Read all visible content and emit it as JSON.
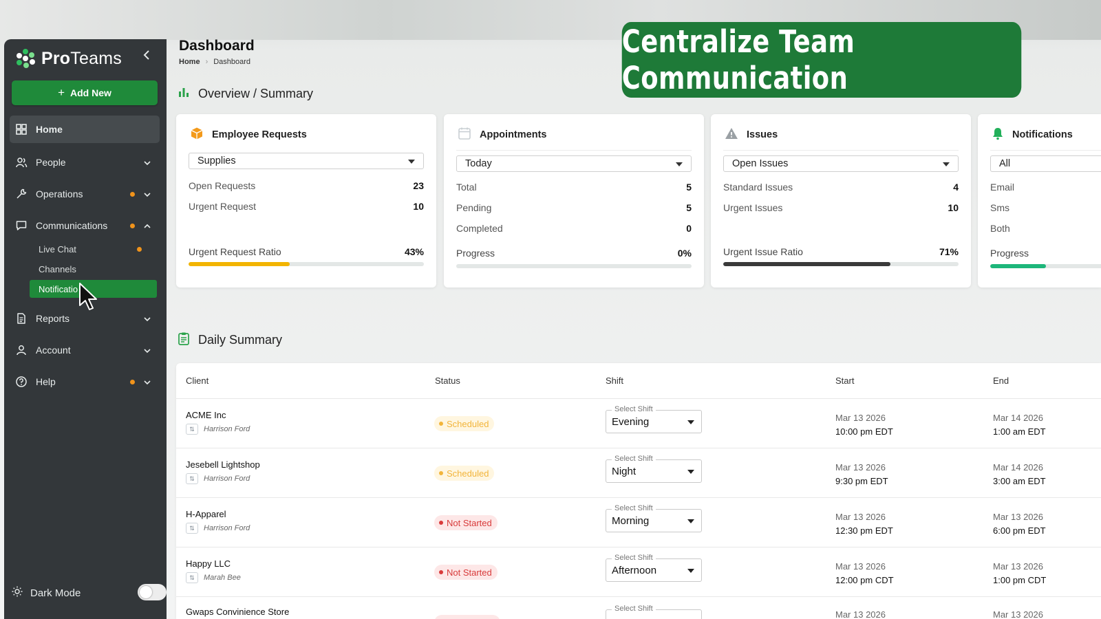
{
  "app": {
    "brand": {
      "name_bold": "Pro",
      "name_rest": "Teams"
    },
    "add_new": "Add New",
    "nav": [
      {
        "id": "home",
        "label": "Home",
        "icon": "grid-icon"
      },
      {
        "id": "people",
        "label": "People",
        "icon": "people-icon"
      },
      {
        "id": "operations",
        "label": "Operations",
        "icon": "wrench-icon"
      },
      {
        "id": "communications",
        "label": "Communications",
        "icon": "chat-icon"
      },
      {
        "id": "reports",
        "label": "Reports",
        "icon": "document-icon"
      },
      {
        "id": "account",
        "label": "Account",
        "icon": "user-icon"
      },
      {
        "id": "help",
        "label": "Help",
        "icon": "help-icon"
      }
    ],
    "communications_sub": [
      {
        "label": "Live Chat"
      },
      {
        "label": "Channels"
      },
      {
        "label": "Notificatio"
      }
    ],
    "dark_mode": "Dark Mode"
  },
  "header": {
    "title": "Dashboard",
    "breadcrumb": [
      "Home",
      "Dashboard"
    ]
  },
  "banner": "Centralize Team Communication",
  "overview": {
    "title": "Overview / Summary",
    "cards": [
      {
        "title": "Employee Requests",
        "filter": "Supplies",
        "stats": [
          {
            "label": "Open Requests",
            "value": "23"
          },
          {
            "label": "Urgent Request",
            "value": "10"
          }
        ],
        "ratio_label": "Urgent Request Ratio",
        "ratio_value": "43%",
        "ratio": 43,
        "bar_color": "#f2b400"
      },
      {
        "title": "Appointments",
        "filter": "Today",
        "stats": [
          {
            "label": "Total",
            "value": "5"
          },
          {
            "label": "Pending",
            "value": "5"
          },
          {
            "label": "Completed",
            "value": "0"
          }
        ],
        "ratio_label": "Progress",
        "ratio_value": "0%",
        "ratio": 0,
        "bar_color": "#28b463"
      },
      {
        "title": "Issues",
        "filter": "Open Issues",
        "stats": [
          {
            "label": "Standard Issues",
            "value": "4"
          },
          {
            "label": "Urgent Issues",
            "value": "10"
          }
        ],
        "ratio_label": "Urgent Issue Ratio",
        "ratio_value": "71%",
        "ratio": 71,
        "bar_color": "#3a3a3a"
      },
      {
        "title": "Notifications",
        "filter": "All",
        "stats": [
          {
            "label": "Email",
            "value": ""
          },
          {
            "label": "Sms",
            "value": ""
          },
          {
            "label": "Both",
            "value": ""
          }
        ],
        "ratio_label": "Progress",
        "ratio_value": "",
        "ratio": 50,
        "bar_color": "#1db67a"
      }
    ]
  },
  "daily": {
    "title": "Daily Summary",
    "columns": [
      "Client",
      "Status",
      "Shift",
      "Start",
      "End"
    ],
    "shift_label": "Select Shift",
    "rows": [
      {
        "client": "ACME Inc",
        "assignee": "Harrison Ford",
        "status": "Scheduled",
        "status_kind": "sched",
        "shift": "Evening",
        "start_date": "Mar 13 2026",
        "start_time": "10:00 pm EDT",
        "end_date": "Mar 14 2026",
        "end_time": "1:00 am EDT"
      },
      {
        "client": "Jesebell Lightshop",
        "assignee": "Harrison Ford",
        "status": "Scheduled",
        "status_kind": "sched",
        "shift": "Night",
        "start_date": "Mar 13 2026",
        "start_time": "9:30 pm EDT",
        "end_date": "Mar 14 2026",
        "end_time": "3:00 am EDT"
      },
      {
        "client": "H-Apparel",
        "assignee": "Harrison Ford",
        "status": "Not Started",
        "status_kind": "notstart",
        "shift": "Morning",
        "start_date": "Mar 13 2026",
        "start_time": "12:30 pm EDT",
        "end_date": "Mar 13 2026",
        "end_time": "6:00 pm EDT"
      },
      {
        "client": "Happy LLC",
        "assignee": "Marah Bee",
        "status": "Not Started",
        "status_kind": "notstart",
        "shift": "Afternoon",
        "start_date": "Mar 13 2026",
        "start_time": "12:00 pm CDT",
        "end_date": "Mar 13 2026",
        "end_time": "1:00 pm CDT"
      },
      {
        "client": "Gwaps Convinience Store",
        "assignee": "",
        "status": "",
        "status_kind": "notstart",
        "shift": "",
        "start_date": "Mar 13 2026",
        "start_time": "",
        "end_date": "Mar 13 2026",
        "end_time": ""
      }
    ]
  },
  "colors": {
    "sidebar": "#33373a",
    "accent_green": "#1f8a3a",
    "dot_orange": "#f0931b"
  }
}
